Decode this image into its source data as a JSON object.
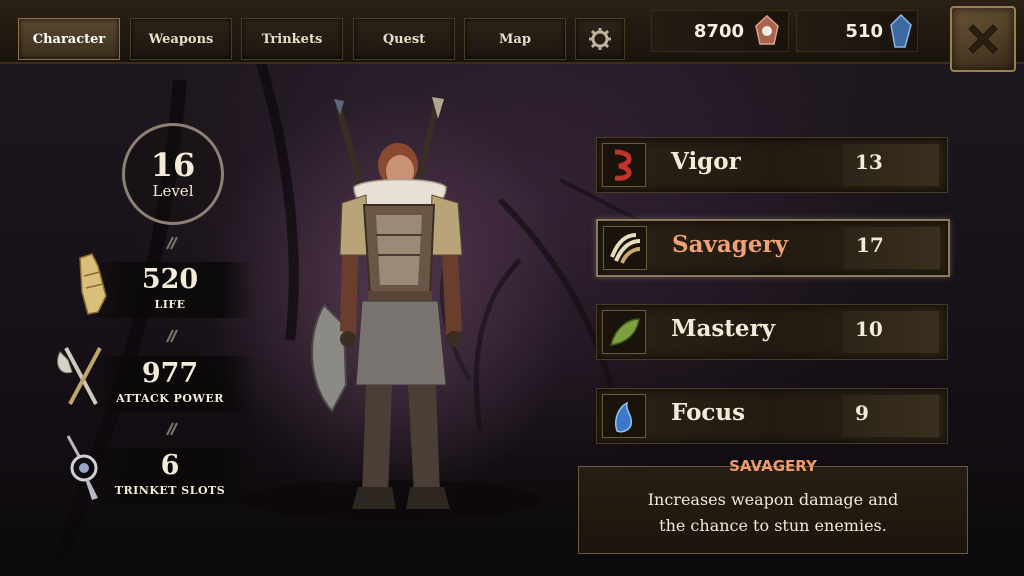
{
  "tabs": [
    {
      "label": "Character",
      "active": true
    },
    {
      "label": "Weapons",
      "active": false
    },
    {
      "label": "Trinkets",
      "active": false
    },
    {
      "label": "Quest",
      "active": false
    },
    {
      "label": "Map",
      "active": false
    }
  ],
  "settings_icon": "gear-icon",
  "currency": {
    "gold": {
      "value": "8700",
      "icon": "red-crystal-icon"
    },
    "gems": {
      "value": "510",
      "icon": "blue-gem-icon"
    }
  },
  "close_icon": "close-x-icon",
  "level": {
    "value": "16",
    "label": "Level"
  },
  "stats": {
    "life": {
      "value": "520",
      "label": "LIFE",
      "icon": "armor-gauntlet-icon"
    },
    "attack": {
      "value": "977",
      "label": "ATTACK POWER",
      "icon": "crossed-weapons-icon"
    },
    "trinkets": {
      "value": "6",
      "label": "TRINKET SLOTS",
      "icon": "amulet-icon"
    }
  },
  "attributes": [
    {
      "name": "Vigor",
      "value": "13",
      "icon": "vigor-icon",
      "selected": false
    },
    {
      "name": "Savagery",
      "value": "17",
      "icon": "savagery-claw-icon",
      "selected": true
    },
    {
      "name": "Mastery",
      "value": "10",
      "icon": "mastery-feather-icon",
      "selected": false
    },
    {
      "name": "Focus",
      "value": "9",
      "icon": "focus-icon",
      "selected": false
    }
  ],
  "description": {
    "title": "SAVAGERY",
    "line1": "Increases weapon damage and",
    "line2": "the chance to stun enemies."
  },
  "colors": {
    "accent": "#ee9b70",
    "panel": "#2a2116",
    "text": "#f3ead8"
  }
}
